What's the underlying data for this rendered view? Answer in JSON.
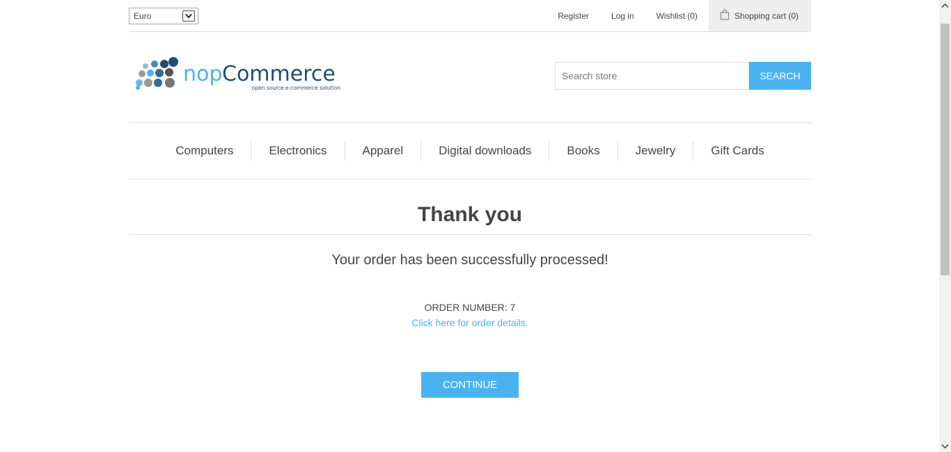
{
  "header": {
    "currency": "Euro",
    "links": {
      "register": "Register",
      "login": "Log in",
      "wishlist": "Wishlist (0)",
      "cart": "Shopping cart (0)"
    }
  },
  "logo": {
    "name": "nopCommerce",
    "tagline": "open source e-commerce solution"
  },
  "search": {
    "placeholder": "Search store",
    "button": "SEARCH"
  },
  "menu": [
    "Computers",
    "Electronics",
    "Apparel",
    "Digital downloads",
    "Books",
    "Jewelry",
    "Gift Cards"
  ],
  "content": {
    "title": "Thank you",
    "message": "Your order has been successfully processed!",
    "order_number": "ORDER NUMBER: 7",
    "details_link": "Click here for order details.",
    "continue": "CONTINUE"
  },
  "colors": {
    "accent": "#4ab2f1",
    "logo_dark": "#1f4e6e"
  }
}
